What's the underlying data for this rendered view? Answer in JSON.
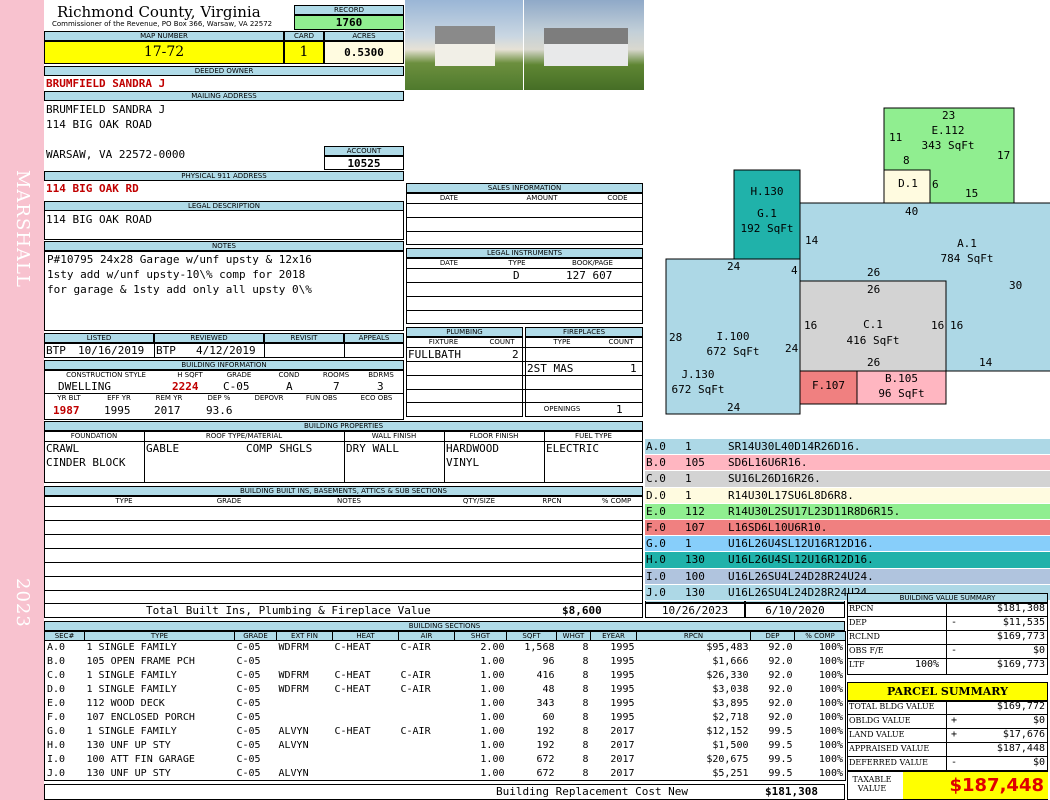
{
  "header": {
    "county": "Richmond County, Virginia",
    "commissioner": "Commissioner of the Revenue, PO Box 366, Warsaw, VA 22572",
    "record_label": "RECORD",
    "record": "1760",
    "map_label": "MAP NUMBER",
    "map": "17-72",
    "card_label": "CARD",
    "card": "1",
    "acres_label": "ACRES",
    "acres": "0.5300"
  },
  "sidebar": {
    "district": "MARSHALL",
    "year": "2023"
  },
  "owner": {
    "deeded_label": "DEEDED OWNER",
    "deeded": "BRUMFIELD SANDRA J",
    "mailing_label": "MAILING ADDRESS",
    "line1": "BRUMFIELD SANDRA J",
    "line2": "114 BIG OAK ROAD",
    "line3": "WARSAW, VA 22572-0000",
    "account_label": "ACCOUNT",
    "account": "10525",
    "phys_label": "PHYSICAL 911 ADDRESS",
    "phys": "114 BIG OAK RD",
    "legal_label": "LEGAL DESCRIPTION",
    "legal": "114 BIG OAK ROAD"
  },
  "notes": {
    "label": "NOTES",
    "l1": "P#10795 24x28 Garage w/unf upsty & 12x16",
    "l2": "1sty add w/unf upsty-10\\% comp for 2018",
    "l3": "for garage & 1sty add only all upsty 0\\%"
  },
  "review": {
    "listed_label": "LISTED",
    "reviewed_label": "REVIEWED",
    "revisit_label": "REVISIT",
    "appeals_label": "APPEALS",
    "listed_by": "BTP",
    "listed": "10/16/2019",
    "reviewed_by": "BTP",
    "reviewed": "4/12/2019"
  },
  "building": {
    "title": "BUILDING INFORMATION",
    "h_style": "CONSTRUCTION STYLE",
    "h_sqft": "H SQFT",
    "h_grade": "GRADE",
    "h_cond": "COND",
    "h_rooms": "ROOMS",
    "h_bdrms": "BDRMS",
    "style": "DWELLING",
    "sqft": "2224",
    "grade": "C-05",
    "cond": "A",
    "rooms": "7",
    "bdrms": "3",
    "h_yrblt": "YR BLT",
    "h_effyr": "EFF YR",
    "h_remyr": "REM YR",
    "h_dep": "DEP %",
    "h_depovr": "DEPOVR",
    "h_funobs": "FUN OBS",
    "h_ecoobs": "ECO OBS",
    "yrblt": "1987",
    "effyr": "1995",
    "remyr": "2017",
    "dep": "93.6"
  },
  "sales": {
    "title": "SALES INFORMATION",
    "h_date": "DATE",
    "h_amount": "AMOUNT",
    "h_code": "CODE"
  },
  "legal_inst": {
    "title": "LEGAL INSTRUMENTS",
    "h_date": "DATE",
    "h_type": "TYPE",
    "h_book": "BOOK/PAGE",
    "type": "D",
    "book": "127 607"
  },
  "plumbing": {
    "title": "PLUMBING",
    "h_fixture": "FIXTURE",
    "h_count": "COUNT",
    "fixture": "FULLBATH",
    "count": "2"
  },
  "fireplaces": {
    "title": "FIREPLACES",
    "h_type": "TYPE",
    "h_count": "COUNT",
    "type": "2ST MAS",
    "count": "1",
    "openings_label": "OPENINGS",
    "openings": "1"
  },
  "properties": {
    "title": "BUILDING PROPERTIES",
    "h_found": "FOUNDATION",
    "h_roof": "ROOF TYPE/MATERIAL",
    "h_wall": "WALL FINISH",
    "h_floor": "FLOOR FINISH",
    "h_fuel": "FUEL TYPE",
    "found1": "CRAWL",
    "found2": "CINDER BLOCK",
    "roof1": "GABLE",
    "roof2": "COMP SHGLS",
    "wall": "DRY WALL",
    "floor1": "HARDWOOD",
    "floor2": "VINYL",
    "fuel": "ELECTRIC"
  },
  "builtins": {
    "title": "BUILDING BUILT INS, BASEMENTS, ATTICS & SUB SECTIONS",
    "h_type": "TYPE",
    "h_grade": "GRADE",
    "h_notes": "NOTES",
    "h_qty": "QTY/SIZE",
    "h_rpcn": "RPCN",
    "h_comp": "% COMP",
    "total_label": "Total Built Ins, Plumbing & Fireplace Value",
    "total": "$8,600"
  },
  "dates": {
    "print_label": "PRINT DATE",
    "print": "10/26/2023",
    "saved_label": "LAST SAVED",
    "saved": "6/10/2020"
  },
  "sections": {
    "title": "BUILDING SECTIONS",
    "headers": [
      "SEC#",
      "TYPE",
      "GRADE",
      "EXT FIN",
      "HEAT",
      "AIR",
      "SHGT",
      "SQFT",
      "WHGT",
      "EYEAR",
      "RPCN",
      "DEP",
      "% COMP"
    ],
    "rows": [
      [
        "A.0",
        "1 SINGLE FAMILY",
        "C-05",
        "WDFRM",
        "C-HEAT",
        "C-AIR",
        "2.00",
        "1,568",
        "8",
        "1995",
        "$95,483",
        "92.0",
        "100%"
      ],
      [
        "B.0",
        "105 OPEN FRAME PCH",
        "C-05",
        "",
        "",
        "",
        "1.00",
        "96",
        "8",
        "1995",
        "$1,666",
        "92.0",
        "100%"
      ],
      [
        "C.0",
        "1 SINGLE FAMILY",
        "C-05",
        "WDFRM",
        "C-HEAT",
        "C-AIR",
        "1.00",
        "416",
        "8",
        "1995",
        "$26,330",
        "92.0",
        "100%"
      ],
      [
        "D.0",
        "1 SINGLE FAMILY",
        "C-05",
        "WDFRM",
        "C-HEAT",
        "C-AIR",
        "1.00",
        "48",
        "8",
        "1995",
        "$3,038",
        "92.0",
        "100%"
      ],
      [
        "E.0",
        "112 WOOD DECK",
        "C-05",
        "",
        "",
        "",
        "1.00",
        "343",
        "8",
        "1995",
        "$3,895",
        "92.0",
        "100%"
      ],
      [
        "F.0",
        "107 ENCLOSED PORCH",
        "C-05",
        "",
        "",
        "",
        "1.00",
        "60",
        "8",
        "1995",
        "$2,718",
        "92.0",
        "100%"
      ],
      [
        "G.0",
        "1 SINGLE FAMILY",
        "C-05",
        "ALVYN",
        "C-HEAT",
        "C-AIR",
        "1.00",
        "192",
        "8",
        "2017",
        "$12,152",
        "99.5",
        "100%"
      ],
      [
        "H.0",
        "130 UNF UP STY",
        "C-05",
        "ALVYN",
        "",
        "",
        "1.00",
        "192",
        "8",
        "2017",
        "$1,500",
        "99.5",
        "100%"
      ],
      [
        "I.0",
        "100 ATT FIN GARAGE",
        "C-05",
        "",
        "",
        "",
        "1.00",
        "672",
        "8",
        "2017",
        "$20,675",
        "99.5",
        "100%"
      ],
      [
        "J.0",
        "130 UNF UP STY",
        "C-05",
        "ALVYN",
        "",
        "",
        "1.00",
        "672",
        "8",
        "2017",
        "$5,251",
        "99.5",
        "100%"
      ]
    ],
    "total_label": "Building Replacement Cost New",
    "total": "$181,308"
  },
  "legend": [
    {
      "id": "A.0",
      "code": "1",
      "path": "SR14U30L40D14R26D16.",
      "color": "#add8e6"
    },
    {
      "id": "B.0",
      "code": "105",
      "path": "SD6L16U6R16.",
      "color": "#ffb6c1"
    },
    {
      "id": "C.0",
      "code": "1",
      "path": "SU16L26D16R26.",
      "color": "#d3d3d3"
    },
    {
      "id": "D.0",
      "code": "1",
      "path": "R14U30L17SU6L8D6R8.",
      "color": "#fffbe0"
    },
    {
      "id": "E.0",
      "code": "112",
      "path": "R14U30L2SU17L23D11R8D6R15.",
      "color": "#90ee90"
    },
    {
      "id": "F.0",
      "code": "107",
      "path": "L16SD6L10U6R10.",
      "color": "#f08080"
    },
    {
      "id": "G.0",
      "code": "1",
      "path": "U16L26U4SL12U16R12D16.",
      "color": "#87cefa"
    },
    {
      "id": "H.0",
      "code": "130",
      "path": "U16L26U4SL12U16R12D16.",
      "color": "#20b2aa"
    },
    {
      "id": "I.0",
      "code": "100",
      "path": "U16L26SU4L24D28R24U24.",
      "color": "#b0c4de"
    },
    {
      "id": "J.0",
      "code": "130",
      "path": "U16L26SU4L24D28R24U24.",
      "color": "#add8e6"
    }
  ],
  "summary": {
    "title": "BUILDING VALUE SUMMARY",
    "rpcn_label": "RPCN",
    "rpcn": "$181,308",
    "dep_label": "DEP",
    "dep_sign": "-",
    "dep": "$11,535",
    "rclnd_label": "RCLND",
    "rclnd": "$169,773",
    "obs_label": "OBS F/E",
    "obs_sign": "-",
    "obs": "$0",
    "ltf_label": "LTF",
    "ltf_pct": "100%",
    "ltf": "$169,773"
  },
  "parcel": {
    "title": "PARCEL SUMMARY",
    "bldg_label": "TOTAL BLDG VALUE",
    "bldg": "$169,772",
    "obldg_label": "OBLDG VALUE",
    "obldg_sign": "+",
    "obldg": "$0",
    "land_label": "LAND VALUE",
    "land_sign": "+",
    "land": "$17,676",
    "appr_label": "APPRAISED VALUE",
    "appr": "$187,448",
    "def_label": "DEFERRED VALUE",
    "def_sign": "-",
    "def": "$0",
    "taxable_label1": "TAXABLE",
    "taxable_label2": "VALUE",
    "taxable": "$187,448"
  },
  "sketch": {
    "A": {
      "name": "A.1",
      "sqft": "784 SqFt"
    },
    "C": {
      "name": "C.1",
      "sqft": "416 SqFt"
    },
    "E": {
      "name": "E.112",
      "sqft": "343 SqFt"
    },
    "G": {
      "name": "G.1",
      "sqft": "192 SqFt"
    },
    "H": {
      "name": "H.130"
    },
    "I": {
      "name": "I.100",
      "sqft": "672 SqFt"
    },
    "J": {
      "name": "J.130",
      "sqft": "672 SqFt"
    },
    "D": {
      "name": "D.1"
    },
    "F": {
      "name": "F.107"
    },
    "B": {
      "name": "B.105",
      "sqft": "96 SqFt"
    },
    "dims": {
      "d23": "23",
      "d11": "11",
      "d17": "17",
      "d8": "8",
      "d6": "6",
      "d15": "15",
      "d40": "40",
      "d14a": "14",
      "d24a": "24",
      "d4": "4",
      "d26a": "26",
      "d26b": "26",
      "d30": "30",
      "d28": "28",
      "d16a": "16",
      "d16b": "16",
      "d16c": "16",
      "d24b": "24",
      "d26c": "26",
      "d14b": "14",
      "d24c": "24"
    }
  }
}
